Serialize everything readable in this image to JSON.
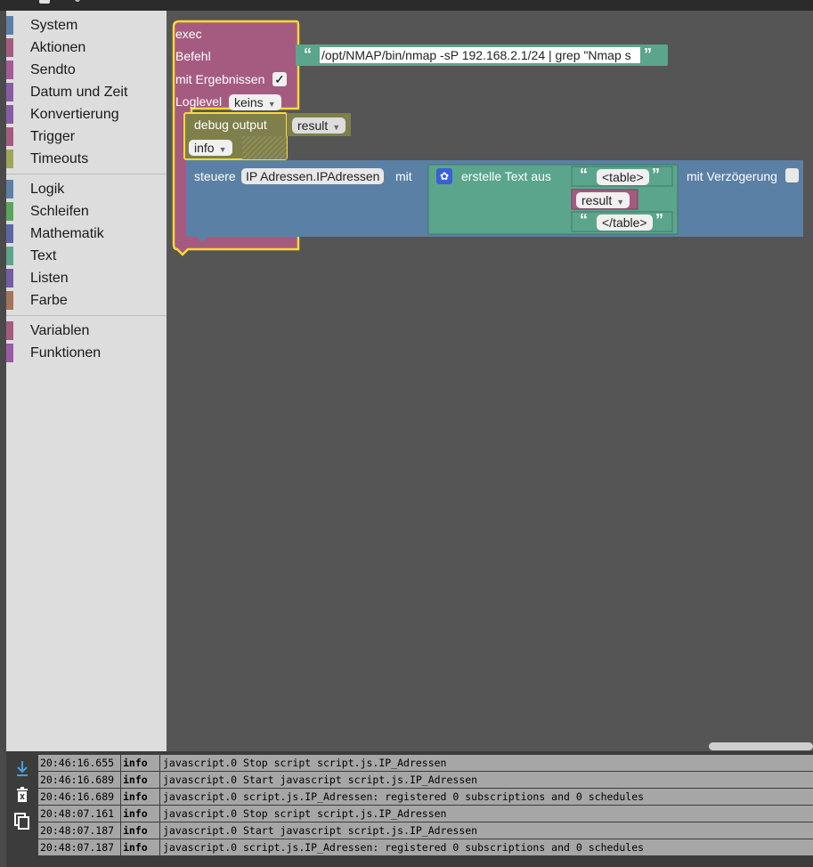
{
  "toolbox": {
    "groups": [
      [
        {
          "label": "System",
          "color": "#5b80a5"
        },
        {
          "label": "Aktionen",
          "color": "#a55b80"
        },
        {
          "label": "Sendto",
          "color": "#a55b99"
        },
        {
          "label": "Datum und Zeit",
          "color": "#8a5ba5"
        },
        {
          "label": "Konvertierung",
          "color": "#8a5ba5"
        },
        {
          "label": "Trigger",
          "color": "#a55b80"
        },
        {
          "label": "Timeouts",
          "color": "#9fa55b"
        }
      ],
      [
        {
          "label": "Logik",
          "color": "#5b80a5"
        },
        {
          "label": "Schleifen",
          "color": "#5ba55b"
        },
        {
          "label": "Mathematik",
          "color": "#5b67a5"
        },
        {
          "label": "Text",
          "color": "#5ba58c"
        },
        {
          "label": "Listen",
          "color": "#745ba5"
        },
        {
          "label": "Farbe",
          "color": "#a5745b"
        }
      ],
      [
        {
          "label": "Variablen",
          "color": "#a55b80"
        },
        {
          "label": "Funktionen",
          "color": "#995ba5"
        }
      ]
    ]
  },
  "blocks": {
    "exec": {
      "title": "exec",
      "befehl_label": "Befehl",
      "befehl_value": "/opt/NMAP/bin/nmap -sP 192.168.2.1/24 | grep \"Nmap s",
      "ergebnissen_label": "mit Ergebnissen",
      "ergebnissen_check": "✓",
      "loglevel_label": "Loglevel",
      "loglevel_value": "keins"
    },
    "debug": {
      "label": "debug output",
      "var": "result",
      "level": "info"
    },
    "steuere": {
      "label": "steuere",
      "target": "IP Adressen.IPAdressen",
      "mit": "mit",
      "verzoegerung": "mit Verzögerung"
    },
    "text_join": {
      "label": "erstelle Text aus",
      "item1": "<table>",
      "item2": "result",
      "item3": "</table>"
    }
  },
  "log": {
    "rows": [
      {
        "time": "20:46:16.655",
        "level": "info",
        "msg": "javascript.0 Stop script script.js.IP_Adressen"
      },
      {
        "time": "20:46:16.689",
        "level": "info",
        "msg": "javascript.0 Start javascript script.js.IP_Adressen"
      },
      {
        "time": "20:46:16.689",
        "level": "info",
        "msg": "javascript.0 script.js.IP_Adressen: registered 0 subscriptions and 0 schedules"
      },
      {
        "time": "20:48:07.161",
        "level": "info",
        "msg": "javascript.0 Stop script script.js.IP_Adressen"
      },
      {
        "time": "20:48:07.187",
        "level": "info",
        "msg": "javascript.0 Start javascript script.js.IP_Adressen"
      },
      {
        "time": "20:48:07.187",
        "level": "info",
        "msg": "javascript.0 script.js.IP_Adressen: registered 0 subscriptions and 0 schedules"
      }
    ]
  },
  "colors": {
    "exec": "#a55b80",
    "debug": "#7f7f4c",
    "steuere": "#5b80a5",
    "text": "#5ba58c",
    "variable": "#a55b80",
    "highlight": "#fdd835"
  }
}
